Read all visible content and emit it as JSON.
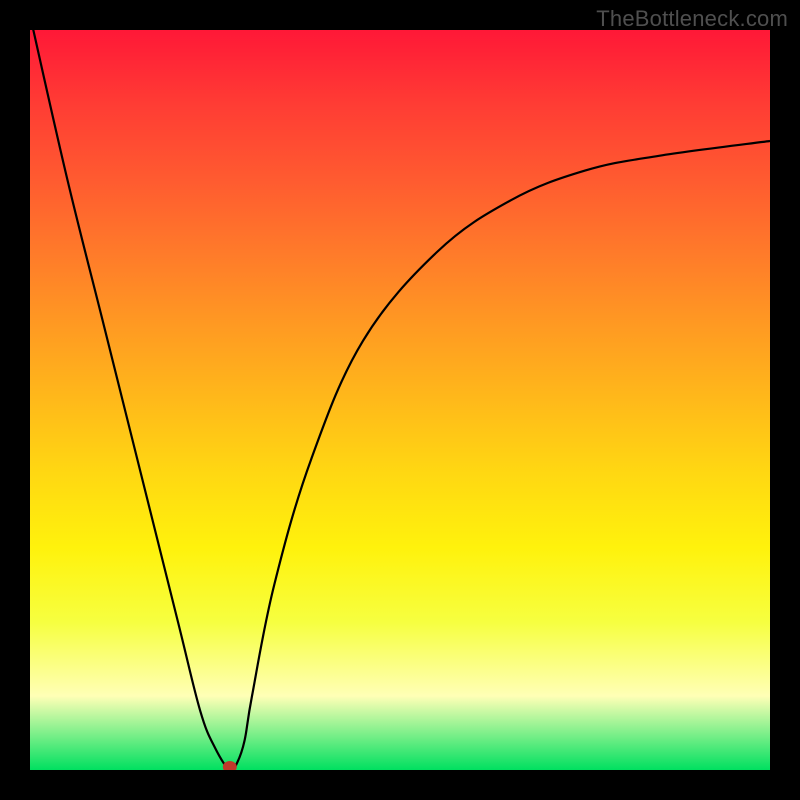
{
  "watermark": "TheBottleneck.com",
  "chart_data": {
    "type": "line",
    "title": "",
    "xlabel": "",
    "ylabel": "",
    "xlim": [
      0,
      100
    ],
    "ylim": [
      0,
      100
    ],
    "x": [
      0,
      5,
      10,
      15,
      20,
      23,
      25,
      27,
      28,
      29,
      30,
      33,
      38,
      45,
      55,
      65,
      75,
      85,
      100
    ],
    "values": [
      102,
      80,
      60,
      40,
      20,
      8,
      3,
      0,
      1,
      4,
      10,
      25,
      42,
      58,
      70,
      77,
      81,
      83,
      85
    ],
    "marker": {
      "x": 27,
      "y": 0,
      "color": "#c0392b"
    },
    "grid": false,
    "legend": false,
    "background_gradient": [
      "#ff1837",
      "#ffd812",
      "#00e060"
    ]
  }
}
